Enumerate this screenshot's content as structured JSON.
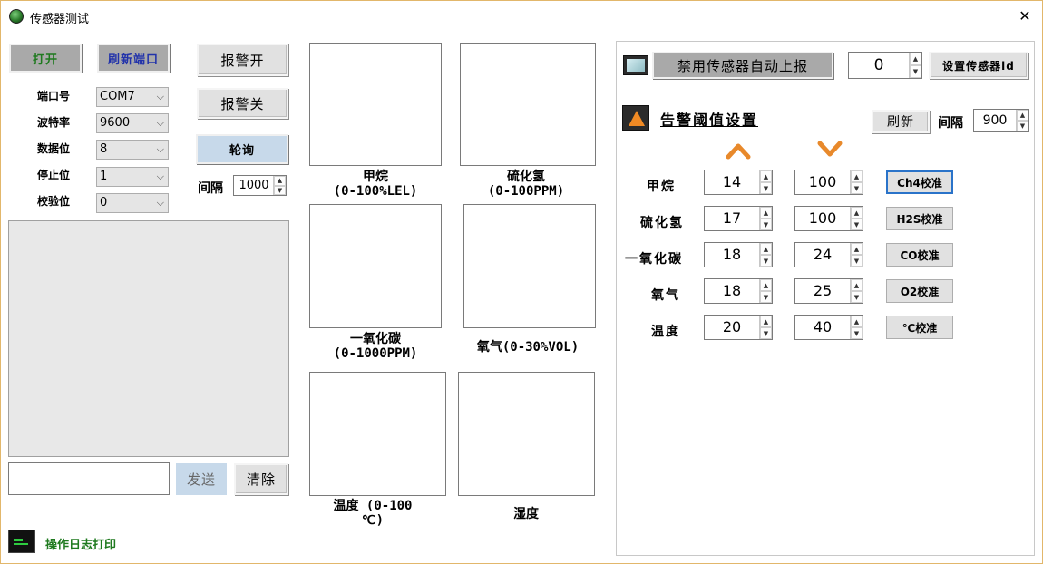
{
  "window": {
    "title": "传感器测试",
    "close_glyph": "✕"
  },
  "serial": {
    "open_label": "打开",
    "refresh_port_label": "刷新端口",
    "fields": [
      {
        "label": "端口号",
        "value": "COM7"
      },
      {
        "label": "波特率",
        "value": "9600"
      },
      {
        "label": "数据位",
        "value": "8"
      },
      {
        "label": "停止位",
        "value": "1"
      },
      {
        "label": "校验位",
        "value": "0"
      }
    ]
  },
  "alarm": {
    "on_label": "报警开",
    "off_label": "报警关"
  },
  "poll": {
    "label": "轮询",
    "interval_label": "间隔",
    "interval_value": "1000"
  },
  "console": {
    "send_label": "发送",
    "clear_label": "清除",
    "input_value": ""
  },
  "log": {
    "label": "操作日志打印"
  },
  "gauges": [
    {
      "line1": "甲烷",
      "line2": "(0-100%LEL)"
    },
    {
      "line1": "硫化氢",
      "line2": "(0-100PPM)"
    },
    {
      "line1": "一氧化碳",
      "line2": "(0-1000PPM)"
    },
    {
      "line1": "氧气(0-30%VOL)",
      "line2": ""
    },
    {
      "line1": "温度 (0-100",
      "line2": "℃)"
    },
    {
      "line1": "湿度",
      "line2": ""
    }
  ],
  "sensor_panel": {
    "disable_report_label": "禁用传感器自动上报",
    "sensor_id_value": "0",
    "set_id_label": "设置传感器id",
    "threshold_title": "告警阈值设置",
    "refresh_label": "刷新",
    "interval_label": "间隔",
    "interval_value": "900",
    "colors": {
      "arrow": "#e8892b",
      "focus": "#2a73c9"
    },
    "rows": [
      {
        "label": "甲烷",
        "low": "14",
        "high": "100",
        "cal": "Ch4校准"
      },
      {
        "label": "硫化氢",
        "low": "17",
        "high": "100",
        "cal": "H2S校准"
      },
      {
        "label": "一氧化碳",
        "low": "18",
        "high": "24",
        "cal": "CO校准"
      },
      {
        "label": "氧气",
        "low": "18",
        "high": "25",
        "cal": "O2校准"
      },
      {
        "label": "温度",
        "low": "20",
        "high": "40",
        "cal": "℃校准"
      }
    ]
  }
}
